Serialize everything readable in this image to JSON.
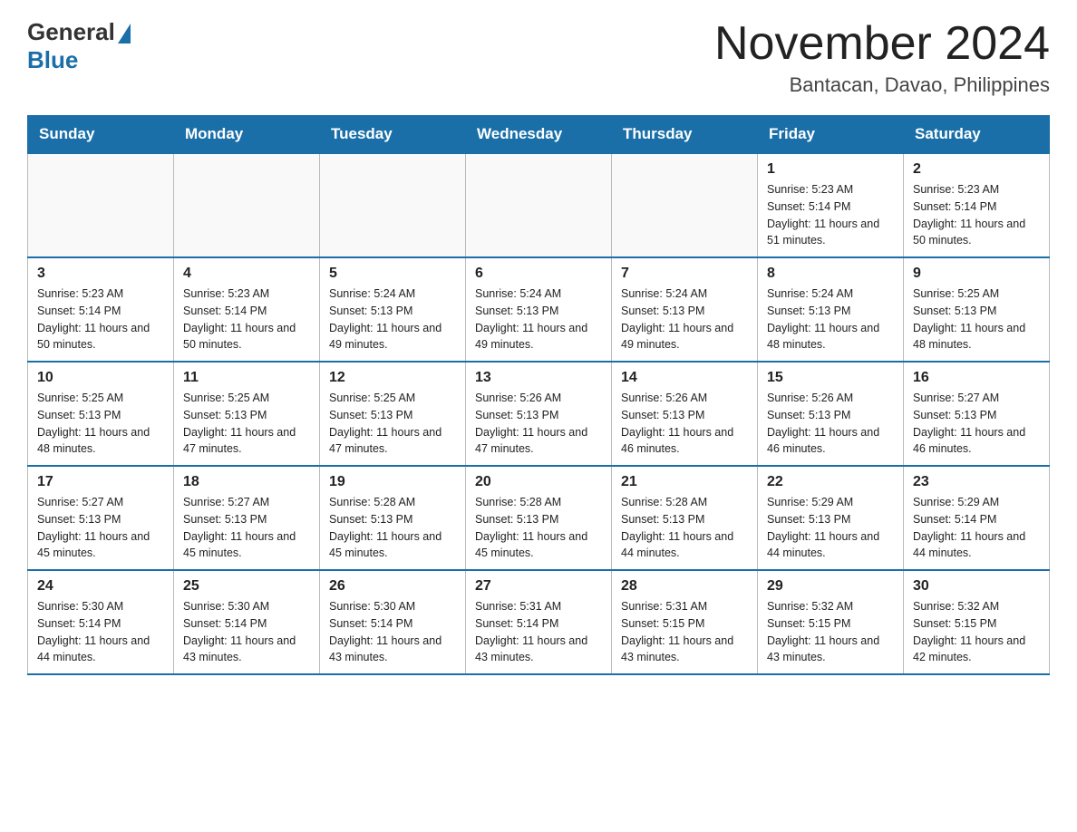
{
  "logo": {
    "general": "General",
    "blue": "Blue"
  },
  "title": {
    "month_year": "November 2024",
    "location": "Bantacan, Davao, Philippines"
  },
  "days_of_week": [
    "Sunday",
    "Monday",
    "Tuesday",
    "Wednesday",
    "Thursday",
    "Friday",
    "Saturday"
  ],
  "weeks": [
    [
      {
        "day": "",
        "info": ""
      },
      {
        "day": "",
        "info": ""
      },
      {
        "day": "",
        "info": ""
      },
      {
        "day": "",
        "info": ""
      },
      {
        "day": "",
        "info": ""
      },
      {
        "day": "1",
        "info": "Sunrise: 5:23 AM\nSunset: 5:14 PM\nDaylight: 11 hours and 51 minutes."
      },
      {
        "day": "2",
        "info": "Sunrise: 5:23 AM\nSunset: 5:14 PM\nDaylight: 11 hours and 50 minutes."
      }
    ],
    [
      {
        "day": "3",
        "info": "Sunrise: 5:23 AM\nSunset: 5:14 PM\nDaylight: 11 hours and 50 minutes."
      },
      {
        "day": "4",
        "info": "Sunrise: 5:23 AM\nSunset: 5:14 PM\nDaylight: 11 hours and 50 minutes."
      },
      {
        "day": "5",
        "info": "Sunrise: 5:24 AM\nSunset: 5:13 PM\nDaylight: 11 hours and 49 minutes."
      },
      {
        "day": "6",
        "info": "Sunrise: 5:24 AM\nSunset: 5:13 PM\nDaylight: 11 hours and 49 minutes."
      },
      {
        "day": "7",
        "info": "Sunrise: 5:24 AM\nSunset: 5:13 PM\nDaylight: 11 hours and 49 minutes."
      },
      {
        "day": "8",
        "info": "Sunrise: 5:24 AM\nSunset: 5:13 PM\nDaylight: 11 hours and 48 minutes."
      },
      {
        "day": "9",
        "info": "Sunrise: 5:25 AM\nSunset: 5:13 PM\nDaylight: 11 hours and 48 minutes."
      }
    ],
    [
      {
        "day": "10",
        "info": "Sunrise: 5:25 AM\nSunset: 5:13 PM\nDaylight: 11 hours and 48 minutes."
      },
      {
        "day": "11",
        "info": "Sunrise: 5:25 AM\nSunset: 5:13 PM\nDaylight: 11 hours and 47 minutes."
      },
      {
        "day": "12",
        "info": "Sunrise: 5:25 AM\nSunset: 5:13 PM\nDaylight: 11 hours and 47 minutes."
      },
      {
        "day": "13",
        "info": "Sunrise: 5:26 AM\nSunset: 5:13 PM\nDaylight: 11 hours and 47 minutes."
      },
      {
        "day": "14",
        "info": "Sunrise: 5:26 AM\nSunset: 5:13 PM\nDaylight: 11 hours and 46 minutes."
      },
      {
        "day": "15",
        "info": "Sunrise: 5:26 AM\nSunset: 5:13 PM\nDaylight: 11 hours and 46 minutes."
      },
      {
        "day": "16",
        "info": "Sunrise: 5:27 AM\nSunset: 5:13 PM\nDaylight: 11 hours and 46 minutes."
      }
    ],
    [
      {
        "day": "17",
        "info": "Sunrise: 5:27 AM\nSunset: 5:13 PM\nDaylight: 11 hours and 45 minutes."
      },
      {
        "day": "18",
        "info": "Sunrise: 5:27 AM\nSunset: 5:13 PM\nDaylight: 11 hours and 45 minutes."
      },
      {
        "day": "19",
        "info": "Sunrise: 5:28 AM\nSunset: 5:13 PM\nDaylight: 11 hours and 45 minutes."
      },
      {
        "day": "20",
        "info": "Sunrise: 5:28 AM\nSunset: 5:13 PM\nDaylight: 11 hours and 45 minutes."
      },
      {
        "day": "21",
        "info": "Sunrise: 5:28 AM\nSunset: 5:13 PM\nDaylight: 11 hours and 44 minutes."
      },
      {
        "day": "22",
        "info": "Sunrise: 5:29 AM\nSunset: 5:13 PM\nDaylight: 11 hours and 44 minutes."
      },
      {
        "day": "23",
        "info": "Sunrise: 5:29 AM\nSunset: 5:14 PM\nDaylight: 11 hours and 44 minutes."
      }
    ],
    [
      {
        "day": "24",
        "info": "Sunrise: 5:30 AM\nSunset: 5:14 PM\nDaylight: 11 hours and 44 minutes."
      },
      {
        "day": "25",
        "info": "Sunrise: 5:30 AM\nSunset: 5:14 PM\nDaylight: 11 hours and 43 minutes."
      },
      {
        "day": "26",
        "info": "Sunrise: 5:30 AM\nSunset: 5:14 PM\nDaylight: 11 hours and 43 minutes."
      },
      {
        "day": "27",
        "info": "Sunrise: 5:31 AM\nSunset: 5:14 PM\nDaylight: 11 hours and 43 minutes."
      },
      {
        "day": "28",
        "info": "Sunrise: 5:31 AM\nSunset: 5:15 PM\nDaylight: 11 hours and 43 minutes."
      },
      {
        "day": "29",
        "info": "Sunrise: 5:32 AM\nSunset: 5:15 PM\nDaylight: 11 hours and 43 minutes."
      },
      {
        "day": "30",
        "info": "Sunrise: 5:32 AM\nSunset: 5:15 PM\nDaylight: 11 hours and 42 minutes."
      }
    ]
  ]
}
